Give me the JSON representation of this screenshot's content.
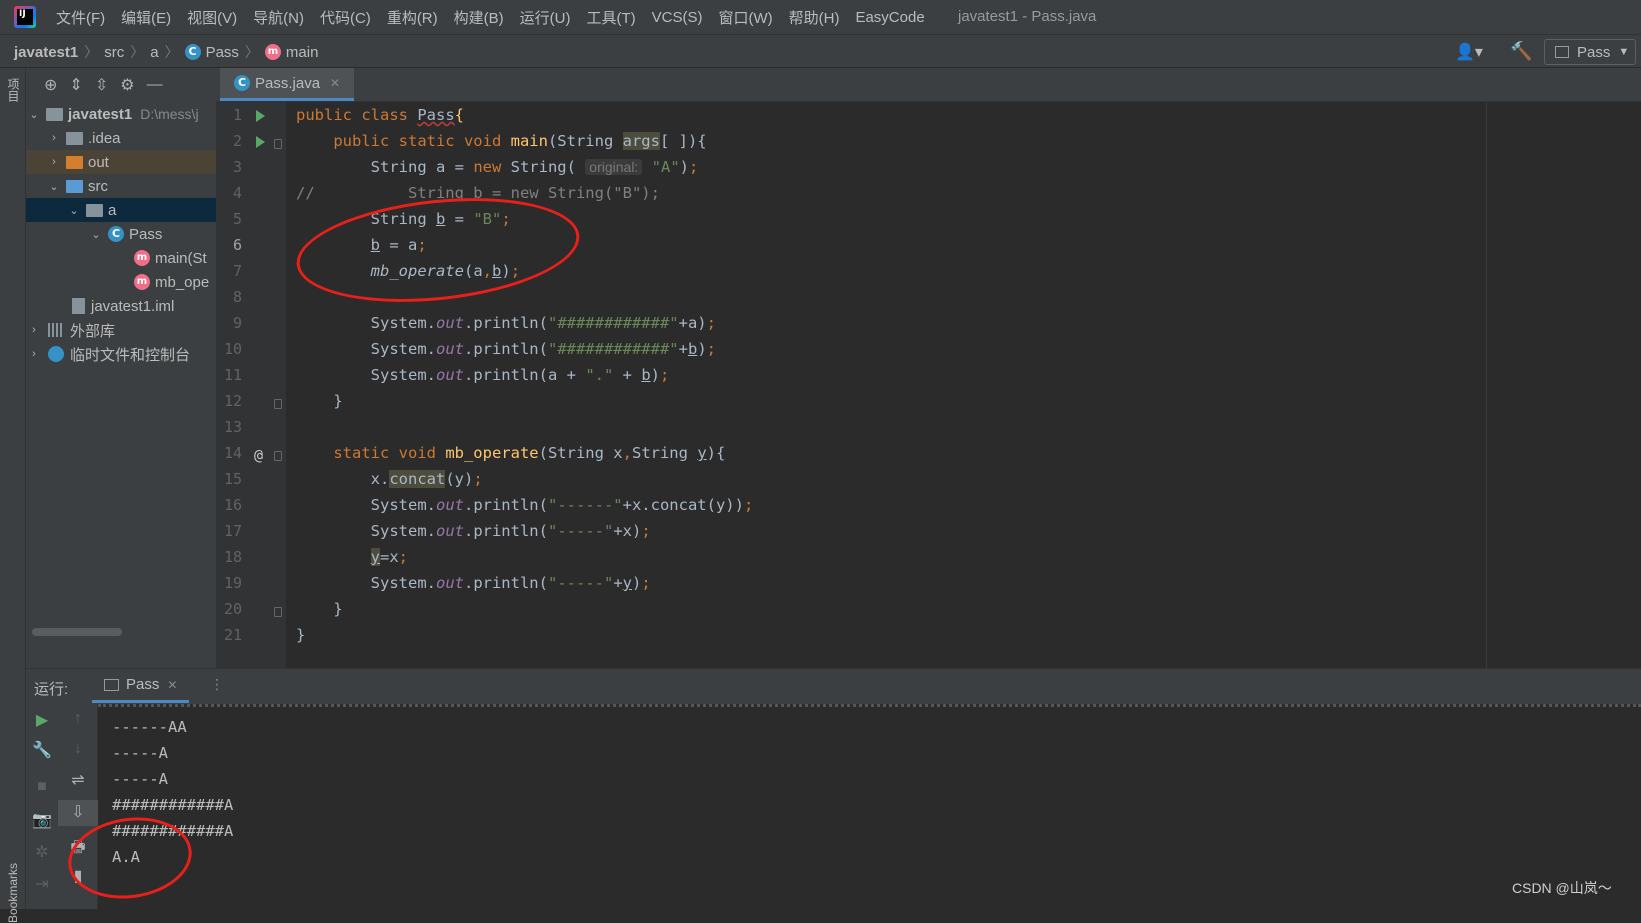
{
  "menu": {
    "items": [
      "文件(F)",
      "编辑(E)",
      "视图(V)",
      "导航(N)",
      "代码(C)",
      "重构(R)",
      "构建(B)",
      "运行(U)",
      "工具(T)",
      "VCS(S)",
      "窗口(W)",
      "帮助(H)",
      "EasyCode"
    ],
    "window_title": "javatest1 - Pass.java"
  },
  "breadcrumb": {
    "project": "javatest1",
    "src": "src",
    "pkg": "a",
    "cls": "Pass",
    "method": "main"
  },
  "toolbar": {
    "run_config": "Pass"
  },
  "side_tabs": {
    "project": "项目",
    "bookmarks": "Bookmarks"
  },
  "project_tree": {
    "root": "javatest1",
    "root_path": "D:\\mess\\j",
    "idea": ".idea",
    "out": "out",
    "src": "src",
    "pkg_a": "a",
    "cls_pass": "Pass",
    "m_main": "main(St",
    "m_mbop": "mb_ope",
    "iml": "javatest1.iml",
    "ext_libs": "外部库",
    "scratches": "临时文件和控制台"
  },
  "editor": {
    "tab": "Pass.java",
    "line_numbers": [
      "1",
      "2",
      "3",
      "4",
      "5",
      "6",
      "7",
      "8",
      "9",
      "10",
      "11",
      "12",
      "13",
      "14",
      "15",
      "16",
      "17",
      "18",
      "19",
      "20",
      "21"
    ],
    "hint_original": "original:"
  },
  "run": {
    "label": "运行:",
    "tab": "Pass",
    "output": [
      "------AA",
      "-----A",
      "-----A",
      "############A",
      "############A",
      "A.A"
    ]
  },
  "watermark": "CSDN @山岚～",
  "colors": {
    "keyword": "#cc7832",
    "string": "#6a8759",
    "method": "#ffc66d",
    "field": "#9876aa",
    "annotation_circle": "#e8201a"
  }
}
